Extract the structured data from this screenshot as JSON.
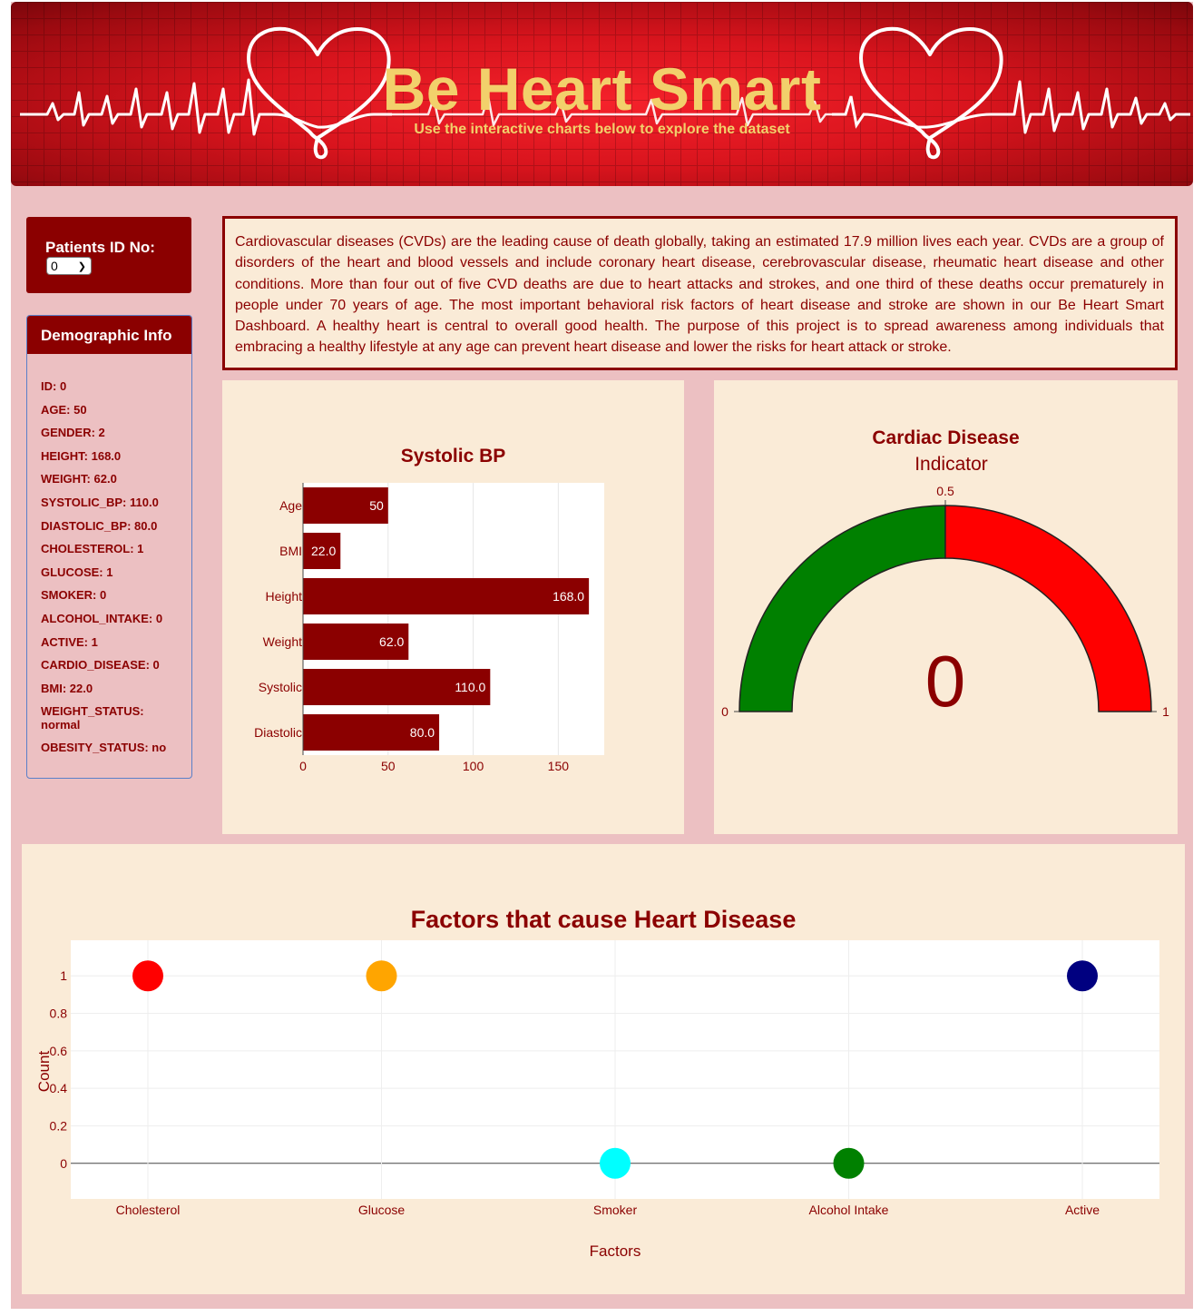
{
  "header": {
    "title": "Be Heart Smart",
    "subtitle": "Use the interactive charts below to explore the dataset"
  },
  "selector": {
    "label": "Patients ID No:",
    "value": "0"
  },
  "demographics": {
    "title": "Demographic Info",
    "items": [
      "ID: 0",
      "AGE: 50",
      "GENDER: 2",
      "HEIGHT: 168.0",
      "WEIGHT: 62.0",
      "SYSTOLIC_BP: 110.0",
      "DIASTOLIC_BP: 80.0",
      "CHOLESTEROL: 1",
      "GLUCOSE: 1",
      "SMOKER: 0",
      "ALCOHOL_INTAKE: 0",
      "ACTIVE: 1",
      "CARDIO_DISEASE: 0",
      "BMI: 22.0",
      "WEIGHT_STATUS: normal",
      "OBESITY_STATUS: no"
    ]
  },
  "info": {
    "text": "Cardiovascular diseases (CVDs) are the leading cause of death globally, taking an estimated 17.9 million lives each year. CVDs are a group of disorders of the heart and blood vessels and include coronary heart disease, cerebrovascular disease, rheumatic heart disease and other conditions. More than four out of five CVD deaths are due to heart attacks and strokes, and one third of these deaths occur prematurely in people under 70 years of age. The most important behavioral risk factors of heart disease and stroke are shown in our Be Heart Smart Dashboard. A healthy heart is central to overall good health. The purpose of this project is to spread awareness among individuals that embracing a healthy lifestyle at any age can prevent heart disease and lower the risks for heart attack or stroke."
  },
  "chart_data": [
    {
      "type": "bar",
      "orientation": "horizontal",
      "title": "Systolic BP",
      "categories": [
        "Age",
        "BMI",
        "Height",
        "Weight",
        "Systolic",
        "Diastolic"
      ],
      "values": [
        50,
        22.0,
        168.0,
        62.0,
        110.0,
        80.0
      ],
      "value_labels": [
        "50",
        "22.0",
        "168.0",
        "62.0",
        "110.0",
        "80.0"
      ],
      "xlim": [
        0,
        177
      ],
      "xticks": [
        0,
        50,
        100,
        150
      ],
      "color": "#8b0000"
    },
    {
      "type": "gauge",
      "title": "Cardiac Disease",
      "subtitle": "Indicator",
      "value": 0,
      "range": [
        0,
        1
      ],
      "tick_labels": [
        "0",
        "0.5",
        "1"
      ],
      "bands": [
        {
          "from": 0,
          "to": 0.5,
          "color": "#008000"
        },
        {
          "from": 0.5,
          "to": 1,
          "color": "#ff0000"
        }
      ]
    },
    {
      "type": "scatter",
      "title": "Factors that cause Heart Disease",
      "xlabel": "Factors",
      "ylabel": "Count",
      "categories": [
        "Cholesterol",
        "Glucose",
        "Smoker",
        "Alcohol Intake",
        "Active"
      ],
      "values": [
        1,
        1,
        0,
        0,
        1
      ],
      "colors": [
        "#ff0000",
        "#ffa500",
        "#00ffff",
        "#008000",
        "#000080"
      ],
      "ylim": [
        -0.19,
        1.19
      ],
      "yticks": [
        0,
        0.2,
        0.4,
        0.6,
        0.8,
        1
      ],
      "ytick_labels": [
        "0",
        "0.2",
        "0.4",
        "0.6",
        "0.8",
        "1"
      ],
      "grid": true
    }
  ]
}
